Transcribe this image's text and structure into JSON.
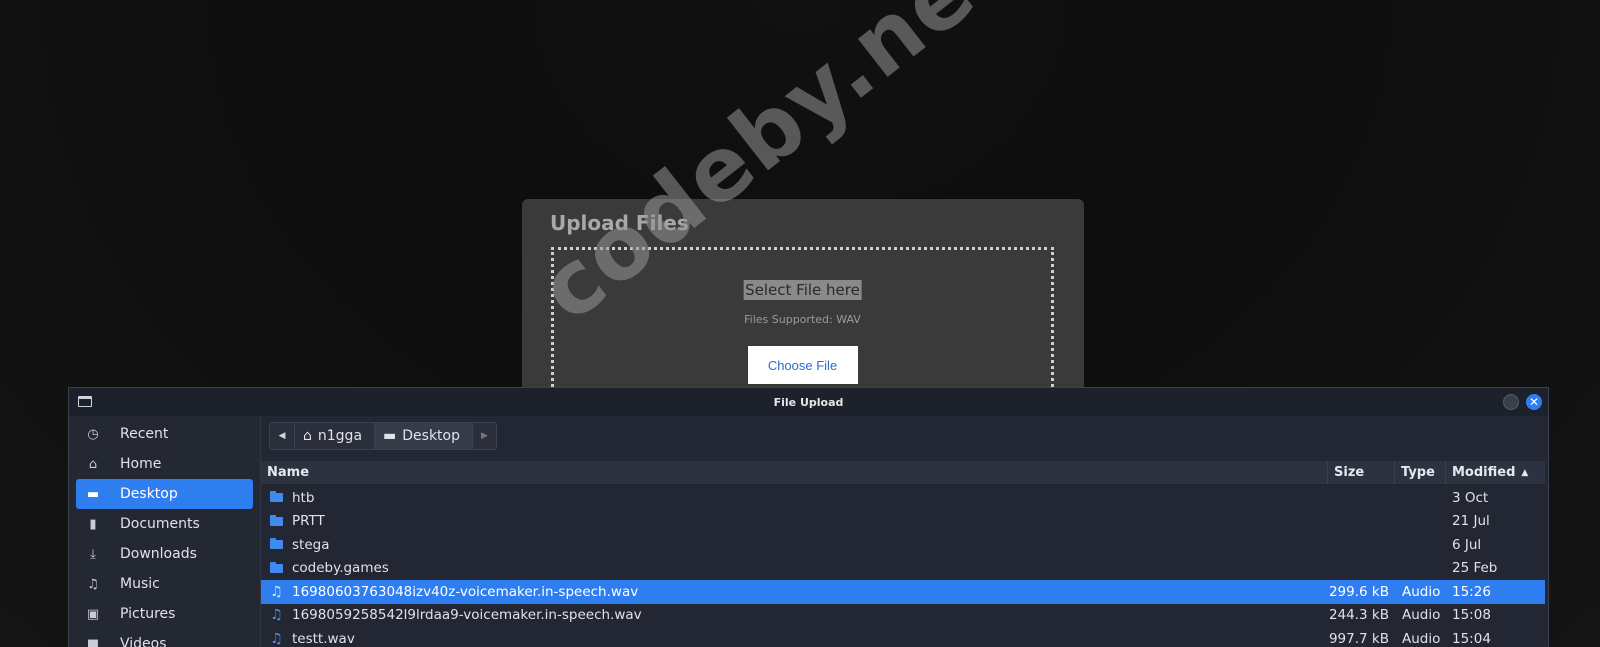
{
  "upload": {
    "title": "Upload Files",
    "select_label": "Select File here",
    "supported_text": "Files Supported: WAV",
    "choose_button": "Choose File"
  },
  "dialog": {
    "title": "File Upload",
    "close_glyph": "✕"
  },
  "sidebar": {
    "items": [
      {
        "label": "Recent",
        "icon": "clock-icon",
        "glyph": "◷"
      },
      {
        "label": "Home",
        "icon": "home-icon",
        "glyph": "⌂"
      },
      {
        "label": "Desktop",
        "icon": "desktop-icon",
        "glyph": "▬"
      },
      {
        "label": "Documents",
        "icon": "document-icon",
        "glyph": "▮"
      },
      {
        "label": "Downloads",
        "icon": "download-icon",
        "glyph": "⤓"
      },
      {
        "label": "Music",
        "icon": "music-icon",
        "glyph": "♫"
      },
      {
        "label": "Pictures",
        "icon": "picture-icon",
        "glyph": "▣"
      },
      {
        "label": "Videos",
        "icon": "video-icon",
        "glyph": "■"
      }
    ],
    "active_index": 2
  },
  "pathbar": {
    "back_glyph": "◀",
    "forward_glyph": "▶",
    "segments": [
      {
        "label": "n1gga",
        "icon": "home-icon",
        "glyph": "⌂"
      },
      {
        "label": "Desktop",
        "icon": "desktop-icon",
        "glyph": "▬"
      }
    ]
  },
  "table": {
    "headers": {
      "name": "Name",
      "size": "Size",
      "type": "Type",
      "modified": "Modified",
      "sort_glyph": "▲"
    },
    "rows": [
      {
        "name": "htb",
        "size": "",
        "type": "",
        "modified": "3 Oct",
        "kind": "folder"
      },
      {
        "name": "PRTT",
        "size": "",
        "type": "",
        "modified": "21 Jul",
        "kind": "folder"
      },
      {
        "name": "stega",
        "size": "",
        "type": "",
        "modified": "6 Jul",
        "kind": "folder"
      },
      {
        "name": "codeby.games",
        "size": "",
        "type": "",
        "modified": "25 Feb",
        "kind": "folder"
      },
      {
        "name": "16980603763048izv40z-voicemaker.in-speech.wav",
        "size": "299.6 kB",
        "type": "Audio",
        "modified": "15:26",
        "kind": "audio",
        "selected": true
      },
      {
        "name": "1698059258542l9lrdaa9-voicemaker.in-speech.wav",
        "size": "244.3 kB",
        "type": "Audio",
        "modified": "15:08",
        "kind": "audio"
      },
      {
        "name": "testt.wav",
        "size": "997.7 kB",
        "type": "Audio",
        "modified": "15:04",
        "kind": "audio"
      }
    ]
  },
  "watermark": "codeby.net",
  "colors": {
    "accent": "#2f7ef0",
    "card": "#3a3a3a",
    "dialog_bg": "#232733"
  }
}
